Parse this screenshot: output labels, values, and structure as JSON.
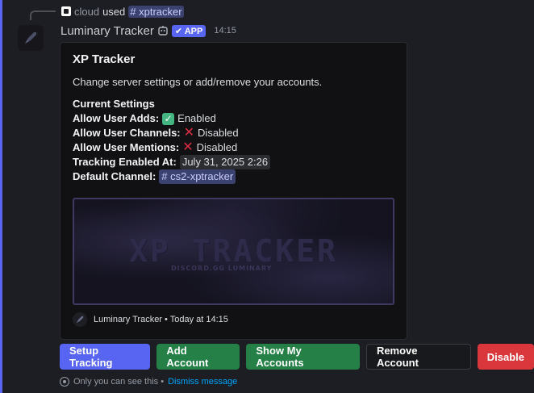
{
  "reply": {
    "user": "cloud",
    "used_text": "used",
    "command": "# xptracker"
  },
  "message": {
    "bot_name": "Luminary Tracker",
    "app_badge": "✔ APP",
    "timestamp": "14:15"
  },
  "embed": {
    "title": "XP Tracker",
    "description": "Change server settings or add/remove your accounts.",
    "settings_header": "Current Settings",
    "rows": [
      {
        "label": "Allow User Adds:",
        "status_icon": "check-mark-icon",
        "value": "Enabled"
      },
      {
        "label": "Allow User Channels:",
        "status_icon": "cross-mark-icon",
        "value": "Disabled"
      },
      {
        "label": "Allow User Mentions:",
        "status_icon": "cross-mark-icon",
        "value": "Disabled"
      }
    ],
    "tracking_label": "Tracking Enabled At:",
    "tracking_value": "July 31, 2025 2:26",
    "channel_label": "Default Channel:",
    "channel_value": "# cs2-xptracker",
    "banner_title": "XP TRACKER",
    "banner_sub": "DISCORD.GG LUMINARY",
    "footer_text": "Luminary Tracker • Today at 14:15"
  },
  "buttons": [
    {
      "label": "Setup Tracking",
      "style": "primary"
    },
    {
      "label": "Add Account",
      "style": "success"
    },
    {
      "label": "Show My Accounts",
      "style": "success"
    },
    {
      "label": "Remove Account",
      "style": "secondary"
    },
    {
      "label": "Disable",
      "style": "danger"
    }
  ],
  "ephemeral": {
    "notice": "Only you can see this •",
    "dismiss": "Dismiss message"
  },
  "colors": {
    "blurple": "#5865f2",
    "green": "#248046",
    "red": "#da373c",
    "link": "#00a8fc"
  }
}
